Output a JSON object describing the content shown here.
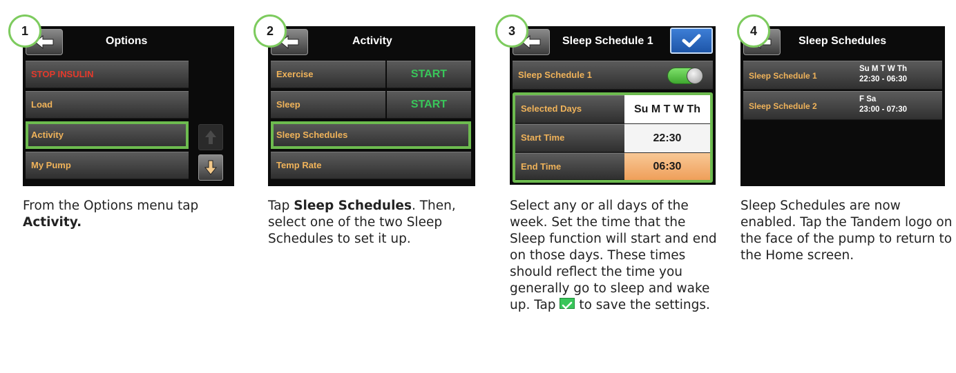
{
  "steps": [
    {
      "badge": "1",
      "title": "Options",
      "menu": [
        "STOP INSULIN",
        "Load",
        "Activity",
        "My Pump"
      ],
      "caption_pre": "From the Options menu tap ",
      "caption_bold": "Activity."
    },
    {
      "badge": "2",
      "title": "Activity",
      "menu": [
        "Exercise",
        "Sleep",
        "Sleep Schedules",
        "Temp Rate"
      ],
      "start_label": "START",
      "caption_pre": "Tap ",
      "caption_bold": "Sleep Schedules",
      "caption_post": ". Then, select one of the two Sleep Schedules to set it up."
    },
    {
      "badge": "3",
      "title": "Sleep Schedule 1",
      "toggle_label": "Sleep Schedule 1",
      "rows": [
        {
          "label": "Selected Days",
          "value": "Su M T W Th"
        },
        {
          "label": "Start Time",
          "value": "22:30"
        },
        {
          "label": "End Time",
          "value": "06:30"
        }
      ],
      "caption_pre": "Select any or all days of the week. Set the time that the Sleep function will start and end on those days. These times should reflect the time you generally go to sleep and wake up. Tap ",
      "caption_post": " to save the settings."
    },
    {
      "badge": "4",
      "title": "Sleep Schedules",
      "schedules": [
        {
          "name": "Sleep Schedule 1",
          "days": "Su M T W Th",
          "times": "22:30 - 06:30"
        },
        {
          "name": "Sleep Schedule 2",
          "days": "F Sa",
          "times": "23:00 - 07:30"
        }
      ],
      "caption": "Sleep Schedules are now enabled. Tap the Tandem logo on the face of the pump to return to the Home screen."
    }
  ],
  "colors": {
    "highlight": "#6dbb4f",
    "menu_text": "#f0b35a",
    "stop_text": "#e43a2c",
    "start_text": "#39c65a",
    "end_time_bg": "#f3b57a",
    "confirm_blue": "#2a66bf"
  },
  "icons": {
    "back": "back-arrow-icon",
    "scroll_up": "arrow-up-icon",
    "scroll_down": "arrow-down-icon",
    "confirm": "checkmark-icon"
  }
}
